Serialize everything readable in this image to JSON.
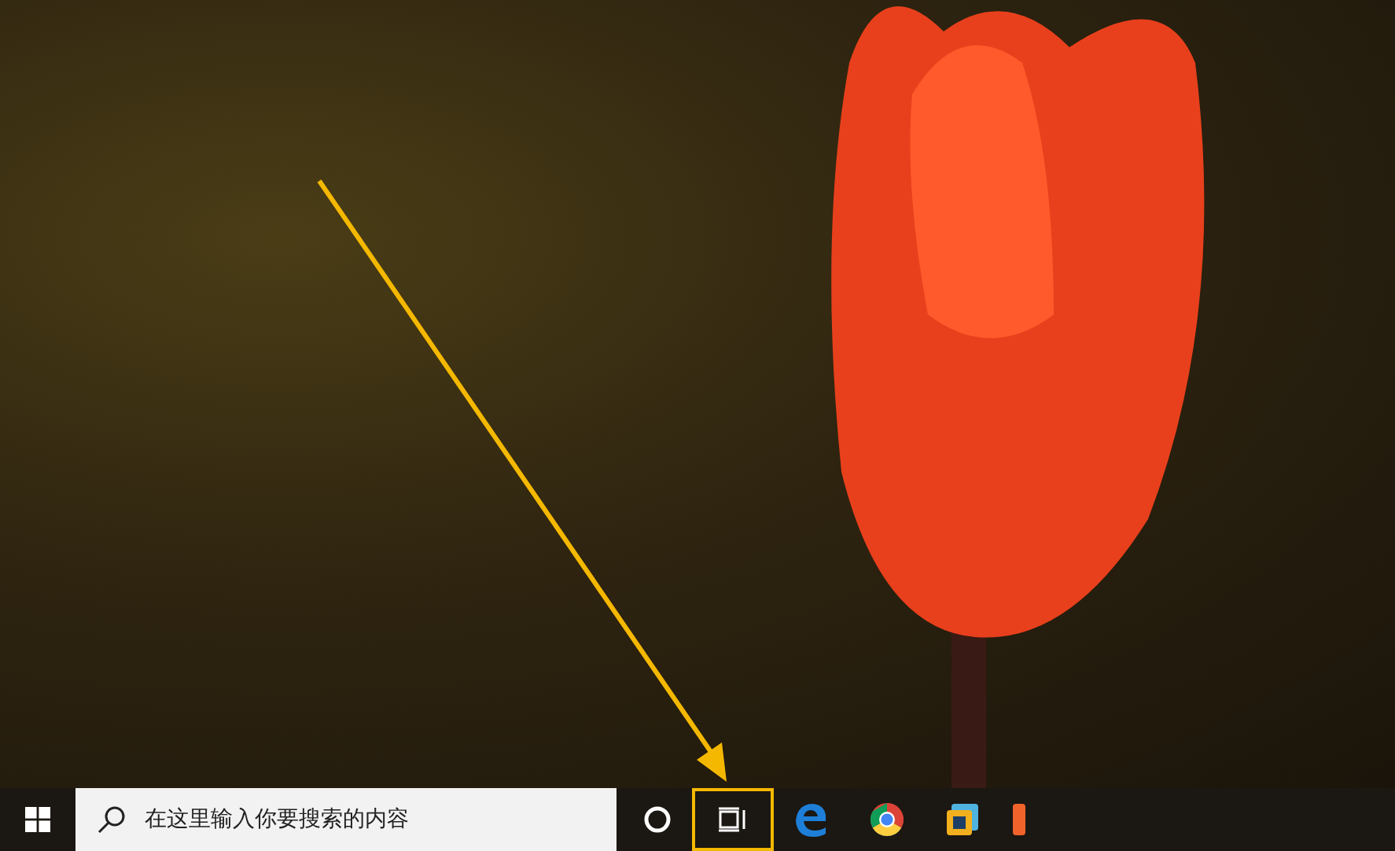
{
  "taskbar": {
    "search": {
      "placeholder": "在这里输入你要搜索的内容"
    },
    "buttons": [
      {
        "kind": "cortana",
        "highlighted": false
      },
      {
        "kind": "taskview",
        "highlighted": true
      },
      {
        "kind": "edge",
        "highlighted": false
      },
      {
        "kind": "chrome",
        "highlighted": false
      },
      {
        "kind": "app",
        "highlighted": false
      },
      {
        "kind": "partial",
        "highlighted": false
      }
    ]
  }
}
